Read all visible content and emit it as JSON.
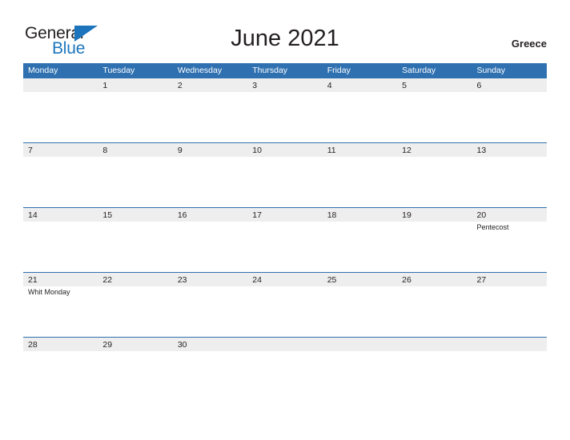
{
  "brand": {
    "name_part1": "General",
    "name_part2": "Blue",
    "flag_icon": "flag-triangle-icon"
  },
  "header": {
    "title": "June 2021",
    "country": "Greece"
  },
  "colors": {
    "header_blue": "#2e70b0",
    "row_band_gray": "#eeeeee",
    "brand_blue": "#1c75bc",
    "text_dark": "#231f20",
    "page_background": "#ffffff"
  },
  "calendar": {
    "weekdays": [
      "Monday",
      "Tuesday",
      "Wednesday",
      "Thursday",
      "Friday",
      "Saturday",
      "Sunday"
    ],
    "weeks": [
      [
        {
          "day": "",
          "event": ""
        },
        {
          "day": "1",
          "event": ""
        },
        {
          "day": "2",
          "event": ""
        },
        {
          "day": "3",
          "event": ""
        },
        {
          "day": "4",
          "event": ""
        },
        {
          "day": "5",
          "event": ""
        },
        {
          "day": "6",
          "event": ""
        }
      ],
      [
        {
          "day": "7",
          "event": ""
        },
        {
          "day": "8",
          "event": ""
        },
        {
          "day": "9",
          "event": ""
        },
        {
          "day": "10",
          "event": ""
        },
        {
          "day": "11",
          "event": ""
        },
        {
          "day": "12",
          "event": ""
        },
        {
          "day": "13",
          "event": ""
        }
      ],
      [
        {
          "day": "14",
          "event": ""
        },
        {
          "day": "15",
          "event": ""
        },
        {
          "day": "16",
          "event": ""
        },
        {
          "day": "17",
          "event": ""
        },
        {
          "day": "18",
          "event": ""
        },
        {
          "day": "19",
          "event": ""
        },
        {
          "day": "20",
          "event": "Pentecost"
        }
      ],
      [
        {
          "day": "21",
          "event": "Whit Monday"
        },
        {
          "day": "22",
          "event": ""
        },
        {
          "day": "23",
          "event": ""
        },
        {
          "day": "24",
          "event": ""
        },
        {
          "day": "25",
          "event": ""
        },
        {
          "day": "26",
          "event": ""
        },
        {
          "day": "27",
          "event": ""
        }
      ],
      [
        {
          "day": "28",
          "event": ""
        },
        {
          "day": "29",
          "event": ""
        },
        {
          "day": "30",
          "event": ""
        },
        {
          "day": "",
          "event": ""
        },
        {
          "day": "",
          "event": ""
        },
        {
          "day": "",
          "event": ""
        },
        {
          "day": "",
          "event": ""
        }
      ]
    ]
  }
}
